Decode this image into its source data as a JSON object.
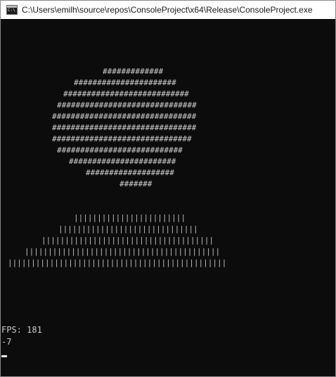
{
  "window": {
    "title": "C:\\Users\\emilh\\source\\repos\\ConsoleProject\\x64\\Release\\ConsoleProject.exe",
    "icon": "console-app-icon"
  },
  "console": {
    "sun": [
      "#############",
      "######################",
      "###########################",
      "##############################",
      "###############################",
      "###############################",
      "##############################",
      "###########################",
      "#######################",
      "###################",
      "#######"
    ],
    "grass": [
      "||||||||||||||||||||||||",
      "||||||||||||||||||||||||||||||",
      "|||||||||||||||||||||||||||||||||||||",
      "||||||||||||||||||||||||||||||||||||||||||",
      "|||||||||||||||||||||||||||||||||||||||||||||||"
    ],
    "fps_line": "FPS: 181",
    "value_line": "-7"
  }
}
